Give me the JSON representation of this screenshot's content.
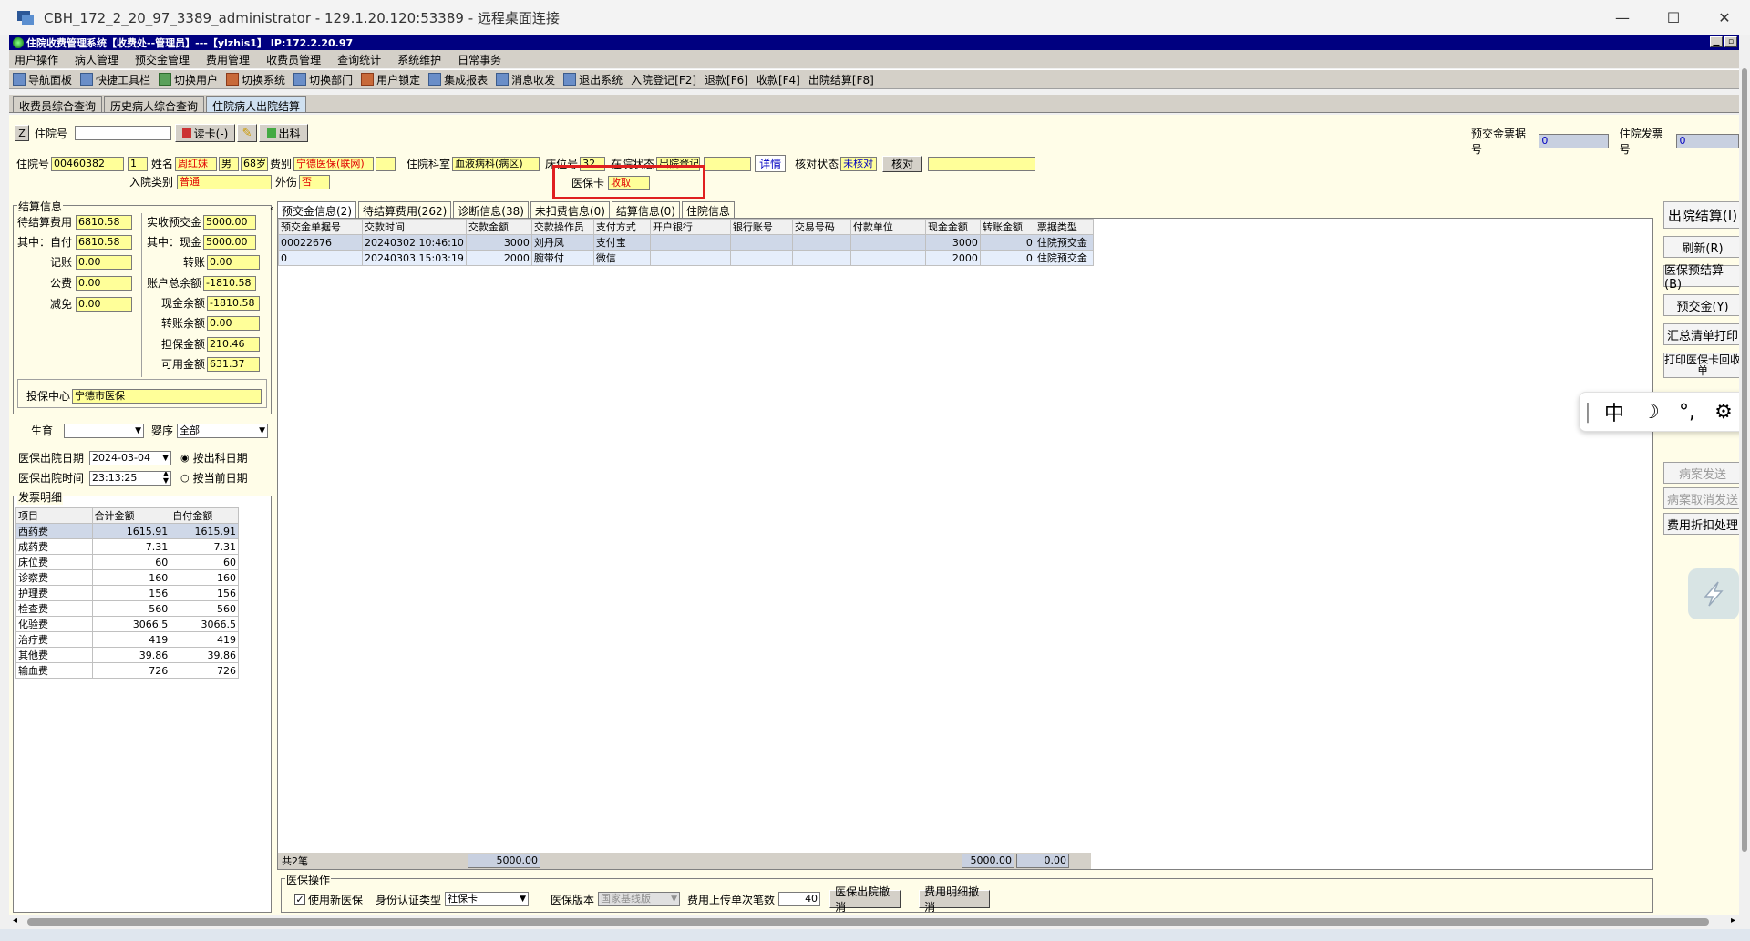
{
  "rdp": {
    "title": "CBH_172_2_20_97_3389_administrator - 129.1.20.120:53389 - 远程桌面连接",
    "min": "—",
    "max": "☐",
    "close": "✕"
  },
  "app": {
    "title": "住院收费管理系统【收费处--管理员】---【ylzhis1】 IP:172.2.20.97"
  },
  "menu": [
    "用户操作",
    "病人管理",
    "预交金管理",
    "费用管理",
    "收费员管理",
    "查询统计",
    "系统维护",
    "日常事务"
  ],
  "toolbar": [
    {
      "label": "导航面板",
      "icon": "navigation-icon"
    },
    {
      "label": "快捷工具栏",
      "icon": "tools-icon"
    },
    {
      "label": "切换用户",
      "icon": "switch-user-icon"
    },
    {
      "label": "切换系统",
      "icon": "switch-system-icon"
    },
    {
      "label": "切换部门",
      "icon": "switch-department-icon"
    },
    {
      "label": "用户锁定",
      "icon": "lock-user-icon"
    },
    {
      "label": "集成报表",
      "icon": "report-icon"
    },
    {
      "label": "消息收发",
      "icon": "message-icon"
    },
    {
      "label": "退出系统",
      "icon": "exit-icon"
    },
    {
      "label": "入院登记[F2]",
      "icon": ""
    },
    {
      "label": "退款[F6]",
      "icon": ""
    },
    {
      "label": "收款[F4]",
      "icon": ""
    },
    {
      "label": "出院结算[F8]",
      "icon": ""
    }
  ],
  "doc_tabs": [
    {
      "label": "收费员综合查询",
      "active": false
    },
    {
      "label": "历史病人综合查询",
      "active": false
    },
    {
      "label": "住院病人出院结算",
      "active": true
    }
  ],
  "top_row": {
    "z_label": "Z",
    "admission_no_label": "住院号",
    "admission_no_value": "",
    "read_card": "读卡(-)",
    "discharge_btn": "出科",
    "prepay_receipt_label": "预交金票据号",
    "prepay_receipt_value": "0",
    "invoice_label": "住院发票号",
    "invoice_value": "0"
  },
  "patient": {
    "admission_no_label": "住院号",
    "admission_no": "00460382",
    "visit": "1",
    "name_label": "姓名",
    "name": "周红妹",
    "sex": "男",
    "age": "68岁",
    "fee_type_label": "费别",
    "fee_type": "宁德医保(联网)",
    "department_label": "住院科室",
    "department": "血液病科(病区)",
    "bed_label": "床位号",
    "bed": "32",
    "status_label": "在院状态",
    "status": "出院登记",
    "detail_link": "详情",
    "check_status_label": "核对状态",
    "check_status": "未核对",
    "check_button": "核对",
    "admission_type_label": "入院类别",
    "admission_type": "普通",
    "injury_label": "外伤",
    "injury": "否",
    "insurance_card_label": "医保卡",
    "insurance_card": "收取"
  },
  "settlement": {
    "caption": "结算信息",
    "pending_label": "待结算费用",
    "pending": "6810.58",
    "self_pay_label": "其中：自付",
    "self_pay": "6810.58",
    "credit_label": "记账",
    "credit": "0.00",
    "public_label": "公费",
    "public": "0.00",
    "reduction_label": "减免",
    "reduction": "0.00",
    "actual_prepay_label": "实收预交金",
    "actual_prepay": "5000.00",
    "cash_label": "其中：现金",
    "cash": "5000.00",
    "transfer_label": "转账",
    "transfer": "0.00",
    "account_balance_label": "账户总余额",
    "account_balance": "-1810.58",
    "cash_balance_label": "现金余额",
    "cash_balance": "-1810.58",
    "transfer_balance_label": "转账余额",
    "transfer_balance": "0.00",
    "guarantee_label": "担保金额",
    "guarantee": "210.46",
    "available_label": "可用金额",
    "available": "631.37",
    "center_label": "投保中心",
    "center": "宁德市医保"
  },
  "birth": {
    "birth_label": "生育",
    "birth_value": "",
    "baby_label": "婴序",
    "baby_value": "全部"
  },
  "discharge": {
    "date_label": "医保出院日期",
    "date": "2024-03-04",
    "time_label": "医保出院时间",
    "time": "23:13:25",
    "opt1": "按出科日期",
    "opt2": "按当前日期"
  },
  "invoice_detail": {
    "caption": "发票明细",
    "headers": [
      "项目",
      "合计金额",
      "自付金额"
    ],
    "rows": [
      [
        "西药费",
        "1615.91",
        "1615.91"
      ],
      [
        "成药费",
        "7.31",
        "7.31"
      ],
      [
        "床位费",
        "60",
        "60"
      ],
      [
        "诊察费",
        "160",
        "160"
      ],
      [
        "护理费",
        "156",
        "156"
      ],
      [
        "检查费",
        "560",
        "560"
      ],
      [
        "化验费",
        "3066.5",
        "3066.5"
      ],
      [
        "治疗费",
        "419",
        "419"
      ],
      [
        "其他费",
        "39.86",
        "39.86"
      ],
      [
        "输血费",
        "726",
        "726"
      ]
    ]
  },
  "inner_tabs": [
    {
      "label": "预交金信息(2)",
      "active": true
    },
    {
      "label": "待结算费用(262)",
      "active": false
    },
    {
      "label": "诊断信息(38)",
      "active": false
    },
    {
      "label": "未扣费信息(0)",
      "active": false
    },
    {
      "label": "结算信息(0)",
      "active": false
    },
    {
      "label": "住院信息",
      "active": false
    }
  ],
  "prepay_table": {
    "headers": [
      "预交金单据号",
      "交款时间",
      "交款金额",
      "交款操作员",
      "支付方式",
      "开户银行",
      "银行账号",
      "交易号码",
      "付款单位",
      "现金金额",
      "转账金额",
      "票据类型"
    ],
    "rows": [
      [
        "00022676",
        "20240302 10:46:10",
        "3000",
        "刘丹凤",
        "支付宝",
        "",
        "",
        "",
        "",
        "3000",
        "0",
        "住院预交金"
      ],
      [
        "0",
        "20240303 15:03:19",
        "2000",
        "腕带付",
        "微信",
        "",
        "",
        "",
        "",
        "2000",
        "0",
        "住院预交金"
      ]
    ],
    "footer_count": "共2笔",
    "footer_total": "5000.00",
    "footer_cash": "5000.00",
    "footer_transfer": "0.00"
  },
  "insurance_ops": {
    "caption": "医保操作",
    "use_new": "使用新医保",
    "id_type_label": "身份认证类型",
    "id_type": "社保卡",
    "version_label": "医保版本",
    "version": "国家基线版",
    "upload_label": "费用上传单次笔数",
    "upload_count": "40",
    "cancel_discharge": "医保出院撤消",
    "cancel_detail": "费用明细撤消"
  },
  "right_buttons": [
    {
      "label": "出院结算(I)",
      "disabled": false
    },
    {
      "label": "刷新(R)",
      "disabled": false
    },
    {
      "label": "医保预结算(B)",
      "disabled": false
    },
    {
      "label": "预交金(Y)",
      "disabled": false
    },
    {
      "label": "汇总清单打印",
      "disabled": false
    },
    {
      "label": "打印医保卡回收单",
      "disabled": false
    },
    {
      "label": "病案发送",
      "disabled": true
    },
    {
      "label": "病案取消发送",
      "disabled": true
    },
    {
      "label": "费用折扣处理",
      "disabled": false
    }
  ],
  "ime": [
    "|",
    "中",
    "☽",
    "°,",
    "⚙"
  ],
  "colors": {
    "title_bar": "#000080",
    "panel_bg": "#fffde8",
    "highlight_red": "#e02020",
    "field_yellow": "#ffff99"
  }
}
